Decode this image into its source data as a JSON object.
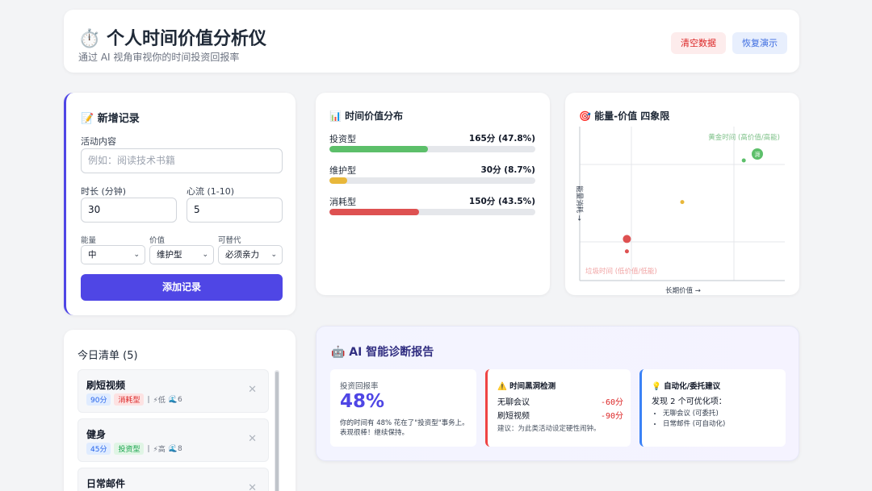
{
  "header": {
    "title": "⏱️ 个人时间价值分析仪",
    "subtitle": "通过 AI 视角审视你的时间投资回报率",
    "clear_label": "清空数据",
    "restore_label": "恢复演示"
  },
  "add_form": {
    "title": "📝 新增记录",
    "activity_label": "活动内容",
    "activity_placeholder": "例如：阅读技术书籍",
    "duration_label": "时长 (分钟)",
    "duration_value": "30",
    "flow_label": "心流 (1-10)",
    "flow_value": "5",
    "energy_label": "能量",
    "energy_value": "中",
    "value_label": "价值",
    "value_value": "维护型",
    "replace_label": "可替代",
    "replace_value": "必须亲力",
    "submit_label": "添加记录"
  },
  "distribution": {
    "title": "📊 时间价值分布",
    "rows": [
      {
        "label": "投资型",
        "value": "165分 (47.8%)",
        "percent": 47.8,
        "color": "#5cbf6a"
      },
      {
        "label": "维护型",
        "value": "30分 (8.7%)",
        "percent": 8.7,
        "color": "#e8b73a"
      },
      {
        "label": "消耗型",
        "value": "150分 (43.5%)",
        "percent": 43.5,
        "color": "#de5151"
      }
    ]
  },
  "quadrant": {
    "title": "🎯 能量-价值 四象限",
    "gold_label": "黄金时间 (高价值/高能)",
    "junk_label": "垃圾时间 (低价值/低能)",
    "x_label": "长期价值 →",
    "y_label": "能量消耗 →",
    "badge_text": "湃",
    "points": [
      {
        "value": 0.8,
        "energy": 0.78,
        "size": "small",
        "color": "#5cbf6a"
      },
      {
        "value": 0.5,
        "energy": 0.51,
        "size": "small",
        "color": "#e8b73a"
      },
      {
        "value": 0.23,
        "energy": 0.27,
        "size": "large",
        "color": "#de5151"
      },
      {
        "value": 0.23,
        "energy": 0.19,
        "size": "small",
        "color": "#de5151"
      }
    ]
  },
  "today_list": {
    "title": "今日清单 (5)",
    "items": [
      {
        "name": "刷短视频",
        "duration": "90分",
        "type": "消耗型",
        "energy": "⚡低",
        "flow": "🌊6"
      },
      {
        "name": "健身",
        "duration": "45分",
        "type": "投资型",
        "energy": "⚡高",
        "flow": "🌊8"
      },
      {
        "name": "日常邮件",
        "duration": "",
        "type": "",
        "energy": "",
        "flow": ""
      }
    ],
    "separator": "|",
    "remove_glyph": "✕"
  },
  "ai_report": {
    "title": "🤖 AI 智能诊断报告",
    "roi_label": "投资回报率",
    "roi_value": "48%",
    "roi_desc": "你的时间有 48% 花在了\"投资型\"事务上。表现很棒！继续保持。",
    "black_title": "⚠️ 时间黑洞检测",
    "black_rows": [
      {
        "name": "无聊会议",
        "value": "-60分"
      },
      {
        "name": "刷短视频",
        "value": "-90分"
      }
    ],
    "black_tip": "建议：为此类活动设定硬性闹钟。",
    "auto_title": "💡 自动化/委托建议",
    "auto_found": "发现 2 个可优化项：",
    "auto_items": [
      "无聊会议 (可委托)",
      "日常邮件 (可自动化)"
    ]
  }
}
